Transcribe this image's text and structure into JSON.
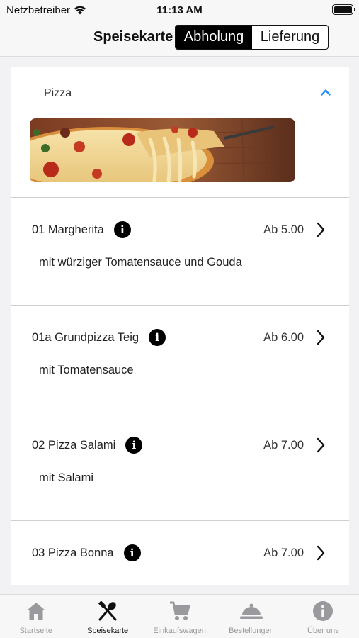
{
  "status_bar": {
    "carrier": "Netzbetreiber",
    "time": "11:13 AM"
  },
  "nav": {
    "title": "Speisekarte",
    "segments": [
      {
        "label": "Abholung",
        "active": true
      },
      {
        "label": "Lieferung",
        "active": false
      }
    ]
  },
  "category": {
    "title": "Pizza",
    "expanded": true,
    "banner_icon": "pizza-photo"
  },
  "menu_items": [
    {
      "name": "01 Margherita",
      "price": "Ab 5.00",
      "description": "mit würziger Tomatensauce und Gouda"
    },
    {
      "name": "01a Grundpizza Teig",
      "price": "Ab 6.00",
      "description": "mit Tomatensauce"
    },
    {
      "name": "02 Pizza Salami",
      "price": "Ab 7.00",
      "description": "mit Salami"
    },
    {
      "name": "03 Pizza Bonna",
      "price": "Ab 7.00",
      "description": ""
    }
  ],
  "tab_bar": {
    "tabs": [
      {
        "label": "Startseite",
        "icon": "home-icon",
        "active": false
      },
      {
        "label": "Speisekarte",
        "icon": "fork-spoon-icon",
        "active": true
      },
      {
        "label": "Einkaufswagen",
        "icon": "cart-icon",
        "active": false
      },
      {
        "label": "Bestellungen",
        "icon": "cloche-icon",
        "active": false
      },
      {
        "label": "Über uns",
        "icon": "info-icon",
        "active": false
      }
    ]
  },
  "colors": {
    "accent": "#1a8cff",
    "inactive_tab": "#9a9a9e",
    "active_tab": "#111111"
  }
}
